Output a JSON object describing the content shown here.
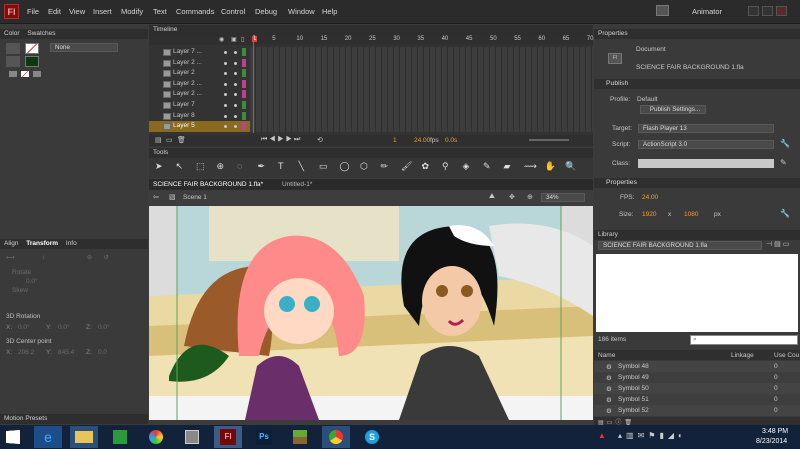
{
  "app": {
    "logo": "Fl",
    "workspace": "Animator",
    "menus": [
      "File",
      "Edit",
      "View",
      "Insert",
      "Modify",
      "Text",
      "Commands",
      "Control",
      "Debug",
      "Window",
      "Help"
    ]
  },
  "left": {
    "tabs": [
      "Color",
      "Swatches"
    ],
    "fill_style": "None",
    "transform_tabs": [
      "Align",
      "Transform",
      "Info"
    ],
    "rotate_label": "Rotate",
    "rotate_value": "0.0°",
    "skew_label": "Skew",
    "rot3d_label": "3D Rotation",
    "x_label": "X:",
    "x_val": "0.0°",
    "y_label": "Y:",
    "y_val": "0.0°",
    "z_label": "Z:",
    "z_val": "0.0°",
    "center_label": "3D Center point",
    "cx": "206.2",
    "cy": "845.4",
    "cz": "0.0",
    "motion_presets": "Motion Presets"
  },
  "timeline": {
    "title": "Timeline",
    "layers": [
      "Layer 7 ...",
      "Layer 2 ...",
      "Layer 2",
      "Layer 2 ...",
      "Layer 2 ...",
      "Layer 7",
      "Layer 8",
      "Layer 5"
    ],
    "ruler": [
      "1",
      "5",
      "10",
      "15",
      "20",
      "25",
      "30",
      "35",
      "40",
      "45",
      "50",
      "55",
      "60",
      "65",
      "70"
    ],
    "frame": "1",
    "fps": "24.00",
    "fps_unit": "fps",
    "time": "0.0s"
  },
  "tools": {
    "title": "Tools"
  },
  "stage": {
    "tabs": [
      "SCIENCE FAIR BACKGROUND 1.fla*",
      "Untitled-1*"
    ],
    "scene": "Scene 1",
    "zoom": "34%"
  },
  "properties": {
    "title": "Properties",
    "doc_type": "Document",
    "doc_name": "SCIENCE FAIR BACKGROUND 1.fla",
    "publish": "Publish",
    "profile_label": "Profile:",
    "profile": "Default",
    "publish_settings": "Publish Settings...",
    "target_label": "Target:",
    "target": "Flash Player 13",
    "script_label": "Script:",
    "script": "ActionScript 3.0",
    "class_label": "Class:",
    "props": "Properties",
    "fps_label": "FPS:",
    "fps": "24.00",
    "size_label": "Size:",
    "w": "1920",
    "x": "x",
    "h": "1080",
    "unit": "px"
  },
  "library": {
    "title": "Library",
    "doc": "SCIENCE FAIR BACKGROUND 1.fla",
    "count": "186 items",
    "cols": [
      "Name",
      "Linkage",
      "Use Cou"
    ],
    "items": [
      {
        "name": "Symbol 48",
        "use": "0"
      },
      {
        "name": "Symbol 49",
        "use": "0"
      },
      {
        "name": "Symbol 50",
        "use": "0"
      },
      {
        "name": "Symbol 51",
        "use": "0"
      },
      {
        "name": "Symbol 52",
        "use": "0"
      }
    ]
  },
  "taskbar": {
    "time": "3:48 PM",
    "date": "8/23/2014"
  },
  "colors": {
    "accent": "#f0a030",
    "selected_layer": "#8a6a1e",
    "playhead": "#e04040"
  }
}
